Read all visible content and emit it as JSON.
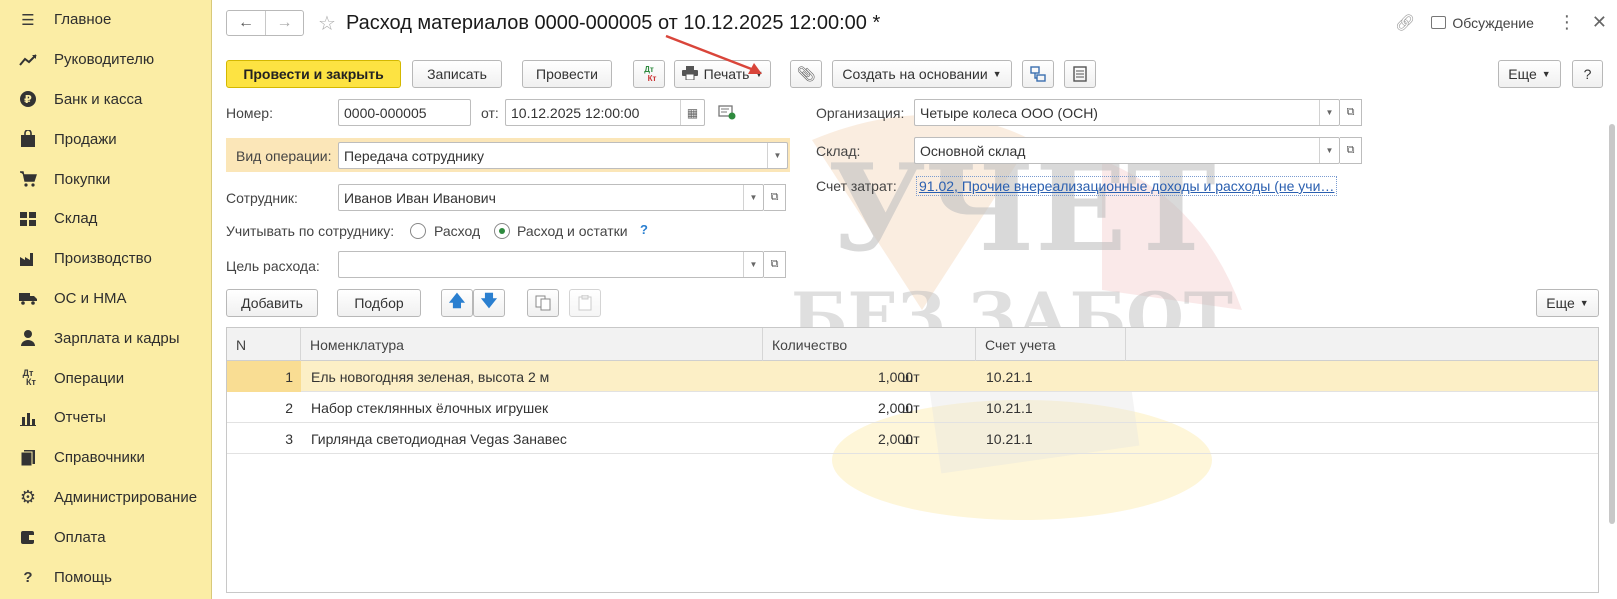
{
  "sidebar": {
    "items": [
      {
        "label": "Главное",
        "icon": "menu-icon"
      },
      {
        "label": "Руководителю",
        "icon": "trend-icon"
      },
      {
        "label": "Банк и касса",
        "icon": "ruble-icon"
      },
      {
        "label": "Продажи",
        "icon": "bag-icon"
      },
      {
        "label": "Покупки",
        "icon": "cart-icon"
      },
      {
        "label": "Склад",
        "icon": "warehouse-icon"
      },
      {
        "label": "Производство",
        "icon": "factory-icon"
      },
      {
        "label": "ОС и НМА",
        "icon": "truck-icon"
      },
      {
        "label": "Зарплата и кадры",
        "icon": "person-icon"
      },
      {
        "label": "Операции",
        "icon": "debit-credit-icon"
      },
      {
        "label": "Отчеты",
        "icon": "bar-chart-icon"
      },
      {
        "label": "Справочники",
        "icon": "book-icon"
      },
      {
        "label": "Администрирование",
        "icon": "gear-icon"
      },
      {
        "label": "Оплата",
        "icon": "wallet-icon"
      },
      {
        "label": "Помощь",
        "icon": "question-icon"
      }
    ]
  },
  "header": {
    "title": "Расход материалов 0000-000005 от 10.12.2025 12:00:00 *",
    "discussion": "Обсуждение"
  },
  "toolbar": {
    "post_close": "Провести и закрыть",
    "save": "Записать",
    "post": "Провести",
    "dtkt_top": "Дт",
    "dtkt_bottom": "Кт",
    "print": "Печать",
    "create_based": "Создать на основании",
    "more": "Еще",
    "help": "?"
  },
  "form": {
    "number_label": "Номер:",
    "number": "0000-000005",
    "date_label": "от:",
    "date": "10.12.2025 12:00:00",
    "org_label": "Организация:",
    "org": "Четыре колеса ООО (ОСН)",
    "op_label": "Вид операции:",
    "op": "Передача сотруднику",
    "warehouse_label": "Склад:",
    "warehouse": "Основной склад",
    "employee_label": "Сотрудник:",
    "employee": "Иванов Иван Иванович",
    "cost_label": "Счет затрат:",
    "cost_account": "91.02, Прочие внереализационные доходы и расходы (не учи…",
    "track_label": "Учитывать по сотруднику:",
    "radio1": "Расход",
    "radio2": "Расход и остатки",
    "radio_selected": 2,
    "purpose_label": "Цель расхода:",
    "purpose": ""
  },
  "table_toolbar": {
    "add": "Добавить",
    "pick": "Подбор",
    "more": "Еще"
  },
  "table": {
    "columns": [
      "N",
      "Номенклатура",
      "Количество",
      "Счет учета"
    ],
    "rows": [
      {
        "n": "1",
        "name": "Ель новогодняя зеленая, высота 2 м",
        "qty": "1,000",
        "unit": "шт",
        "account": "10.21.1"
      },
      {
        "n": "2",
        "name": "Набор стеклянных ёлочных игрушек",
        "qty": "2,000",
        "unit": "шт",
        "account": "10.21.1"
      },
      {
        "n": "3",
        "name": "Гирлянда светодиодная Vegas Занавес",
        "qty": "2,000",
        "unit": "шт",
        "account": "10.21.1"
      }
    ],
    "selected_row": 0
  },
  "watermark": {
    "line1": "УЧЕТ",
    "line2": "БЕЗ ЗАБОТ"
  },
  "colors": {
    "sidebar_bg": "#fbeda5",
    "primary_button": "#fde342",
    "selected_row": "#fcefc6",
    "link": "#2a5fb0",
    "arrow": "#d9453a"
  }
}
